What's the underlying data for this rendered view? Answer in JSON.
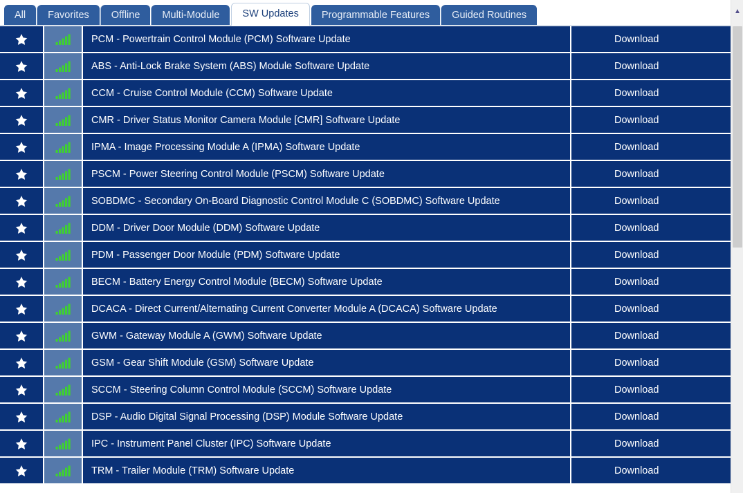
{
  "tabs": [
    {
      "label": "All",
      "active": false
    },
    {
      "label": "Favorites",
      "active": false
    },
    {
      "label": "Offline",
      "active": false
    },
    {
      "label": "Multi-Module",
      "active": false
    },
    {
      "label": "SW Updates",
      "active": true
    },
    {
      "label": "Programmable Features",
      "active": false
    },
    {
      "label": "Guided Routines",
      "active": false
    }
  ],
  "colors": {
    "row_background": "#0a3177",
    "signal_cell_background": "#5579ab",
    "tab_inactive": "#2f5d9e",
    "tab_active_text": "#1b3f7a",
    "signal_bar_green": "#3fd130",
    "page_background": "#ffffff"
  },
  "icons": {
    "favorite": "star-icon",
    "signal": "signal-bars-icon",
    "scroll_up": "scroll-up-arrow-icon"
  },
  "action_label": "Download",
  "rows": [
    {
      "title": "PCM - Powertrain Control Module (PCM) Software Update",
      "action": "Download"
    },
    {
      "title": "ABS - Anti-Lock Brake System (ABS) Module Software Update",
      "action": "Download"
    },
    {
      "title": "CCM - Cruise Control Module (CCM) Software Update",
      "action": "Download"
    },
    {
      "title": "CMR - Driver Status Monitor Camera Module [CMR] Software Update",
      "action": "Download"
    },
    {
      "title": "IPMA - Image Processing Module A (IPMA) Software Update",
      "action": "Download"
    },
    {
      "title": "PSCM - Power Steering Control Module (PSCM) Software Update",
      "action": "Download"
    },
    {
      "title": "SOBDMC - Secondary On-Board Diagnostic Control Module C (SOBDMC) Software Update",
      "action": "Download"
    },
    {
      "title": "DDM - Driver Door Module (DDM) Software Update",
      "action": "Download"
    },
    {
      "title": "PDM - Passenger Door Module (PDM) Software Update",
      "action": "Download"
    },
    {
      "title": "BECM - Battery Energy Control Module (BECM) Software Update",
      "action": "Download"
    },
    {
      "title": "DCACA - Direct Current/Alternating Current Converter Module A (DCACA) Software Update",
      "action": "Download"
    },
    {
      "title": "GWM - Gateway Module A (GWM) Software Update",
      "action": "Download"
    },
    {
      "title": "GSM - Gear Shift Module (GSM) Software Update",
      "action": "Download"
    },
    {
      "title": "SCCM - Steering Column Control Module (SCCM) Software Update",
      "action": "Download"
    },
    {
      "title": "DSP - Audio Digital Signal Processing (DSP) Module Software Update",
      "action": "Download"
    },
    {
      "title": "IPC - Instrument Panel Cluster (IPC) Software Update",
      "action": "Download"
    },
    {
      "title": "TRM - Trailer Module (TRM) Software Update",
      "action": "Download"
    }
  ]
}
